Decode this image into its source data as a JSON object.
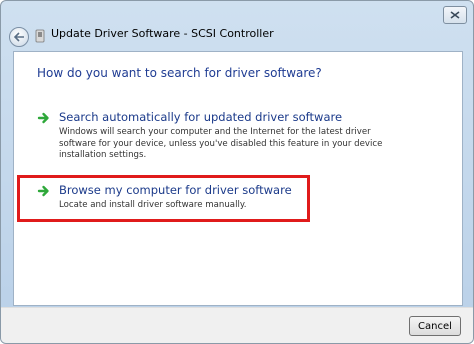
{
  "window": {
    "title": "Update Driver Software - SCSI Controller",
    "icons": {
      "close": "close-icon",
      "back": "back-arrow-icon",
      "device": "device-icon"
    }
  },
  "main": {
    "heading": "How do you want to search for driver software?",
    "options": [
      {
        "title": "Search automatically for updated driver software",
        "description": "Windows will search your computer and the Internet for the latest driver software for your device, unless you've disabled this feature in your device installation settings.",
        "icon": "green-arrow-icon"
      },
      {
        "title": "Browse my computer for driver software",
        "description": "Locate and install driver software manually.",
        "icon": "green-arrow-icon"
      }
    ]
  },
  "footer": {
    "cancel_label": "Cancel"
  },
  "colors": {
    "heading": "#1f3c93",
    "option_title": "#1b3a8a",
    "highlight": "#e01b1b",
    "arrow": "#2ea83a"
  }
}
